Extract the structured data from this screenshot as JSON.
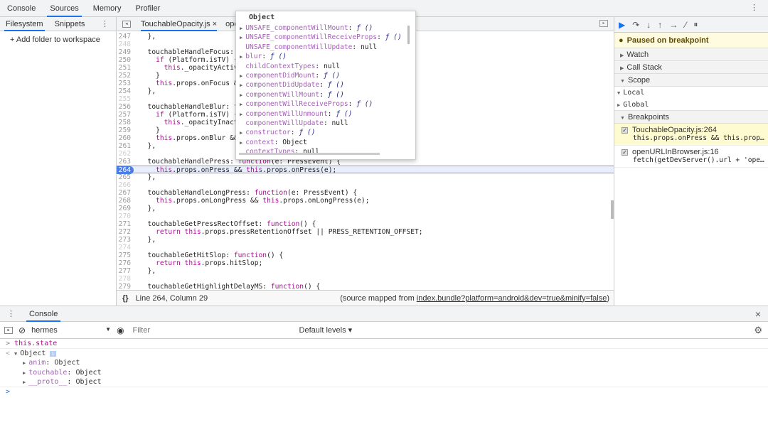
{
  "top_tabs": [
    {
      "label": "Console"
    },
    {
      "label": "Sources",
      "active": true
    },
    {
      "label": "Memory"
    },
    {
      "label": "Profiler"
    }
  ],
  "left": {
    "tabs": [
      "Filesystem",
      "Snippets"
    ],
    "add_folder": "+ Add folder to workspace"
  },
  "editor": {
    "tabs": [
      {
        "label": "TouchableOpacity.js",
        "active": true
      },
      {
        "label": "oper"
      }
    ],
    "lines": [
      {
        "n": 247,
        "t": "  },"
      },
      {
        "n": 248,
        "t": ""
      },
      {
        "n": 249,
        "t": "  touchableHandleFocus: f"
      },
      {
        "n": 250,
        "t": "    if (Platform.isTV) {"
      },
      {
        "n": 251,
        "t": "      this._opacityActive"
      },
      {
        "n": 252,
        "t": "    }"
      },
      {
        "n": 253,
        "t": "    this.props.onFocus &&"
      },
      {
        "n": 254,
        "t": "  },"
      },
      {
        "n": 255,
        "t": ""
      },
      {
        "n": 256,
        "t": "  touchableHandleBlur: fu"
      },
      {
        "n": 257,
        "t": "    if (Platform.isTV) {"
      },
      {
        "n": 258,
        "t": "      this._opacityInact"
      },
      {
        "n": 259,
        "t": "    }"
      },
      {
        "n": 260,
        "t": "    this.props.onBlur &&"
      },
      {
        "n": 261,
        "t": "  },"
      },
      {
        "n": 262,
        "t": ""
      },
      {
        "n": 263,
        "t": "  touchableHandlePress: function(e: PressEvent) {"
      },
      {
        "n": 264,
        "t": "    this.props.onPress && this.props.onPress(e);",
        "breakpoint": true
      },
      {
        "n": 265,
        "t": "  },"
      },
      {
        "n": 266,
        "t": ""
      },
      {
        "n": 267,
        "t": "  touchableHandleLongPress: function(e: PressEvent) {"
      },
      {
        "n": 268,
        "t": "    this.props.onLongPress && this.props.onLongPress(e);"
      },
      {
        "n": 269,
        "t": "  },"
      },
      {
        "n": 270,
        "t": ""
      },
      {
        "n": 271,
        "t": "  touchableGetPressRectOffset: function() {"
      },
      {
        "n": 272,
        "t": "    return this.props.pressRetentionOffset || PRESS_RETENTION_OFFSET;"
      },
      {
        "n": 273,
        "t": "  },"
      },
      {
        "n": 274,
        "t": ""
      },
      {
        "n": 275,
        "t": "  touchableGetHitSlop: function() {"
      },
      {
        "n": 276,
        "t": "    return this.props.hitSlop;"
      },
      {
        "n": 277,
        "t": "  },"
      },
      {
        "n": 278,
        "t": ""
      },
      {
        "n": 279,
        "t": "  touchableGetHighlightDelayMS: function() {"
      }
    ],
    "status": {
      "position": "Line 264, Column 29",
      "source_prefix": "(source mapped from ",
      "source_link": "index.bundle?platform=android&dev=true&minify=false",
      "source_suffix": ")"
    }
  },
  "popup": {
    "title": "Object",
    "rows": [
      {
        "name": "UNSAFE_componentWillMount",
        "value": "ƒ ()",
        "expand": true
      },
      {
        "name": "UNSAFE_componentWillReceiveProps",
        "value": "ƒ ()",
        "expand": true
      },
      {
        "name": "UNSAFE_componentWillUpdate",
        "value": "null",
        "expand": false
      },
      {
        "name": "blur",
        "value": "ƒ ()",
        "expand": true
      },
      {
        "name": "childContextTypes",
        "value": "null",
        "expand": false
      },
      {
        "name": "componentDidMount",
        "value": "ƒ ()",
        "expand": true
      },
      {
        "name": "componentDidUpdate",
        "value": "ƒ ()",
        "expand": true
      },
      {
        "name": "componentWillMount",
        "value": "ƒ ()",
        "expand": true
      },
      {
        "name": "componentWillReceiveProps",
        "value": "ƒ ()",
        "expand": true
      },
      {
        "name": "componentWillUnmount",
        "value": "ƒ ()",
        "expand": true
      },
      {
        "name": "componentWillUpdate",
        "value": "null",
        "expand": false
      },
      {
        "name": "constructor",
        "value": "ƒ ()",
        "expand": true
      },
      {
        "name": "context",
        "value": "Object",
        "expand": true
      },
      {
        "name": "contextTypes",
        "value": "null",
        "expand": false
      }
    ]
  },
  "right": {
    "paused": "Paused on breakpoint",
    "sections": {
      "watch": "Watch",
      "callstack": "Call Stack",
      "scope": "Scope",
      "breakpoints": "Breakpoints"
    },
    "scope": [
      "Local",
      "Global"
    ],
    "breakpoints": [
      {
        "file": "TouchableOpacity.js:264",
        "code": "this.props.onPress && this.prop…",
        "highlight": true
      },
      {
        "file": "openURLInBrowser.js:16",
        "code": "fetch(getDevServer().url + 'ope…",
        "highlight": false
      }
    ]
  },
  "drawer": {
    "tab": "Console",
    "context": "hermes",
    "filter_placeholder": "Filter",
    "levels": "Default levels ▾",
    "output": {
      "input": "this.state",
      "result": "Object",
      "children": [
        {
          "name": "anim",
          "value": "Object"
        },
        {
          "name": "touchable",
          "value": "Object"
        },
        {
          "name": "__proto__",
          "value": "Object"
        }
      ]
    }
  },
  "colors": {
    "accent": "#1a73e8",
    "breakpoint": "#4a7de8",
    "paused_bg": "#fffbe0",
    "keyword": "#aa0d91"
  }
}
